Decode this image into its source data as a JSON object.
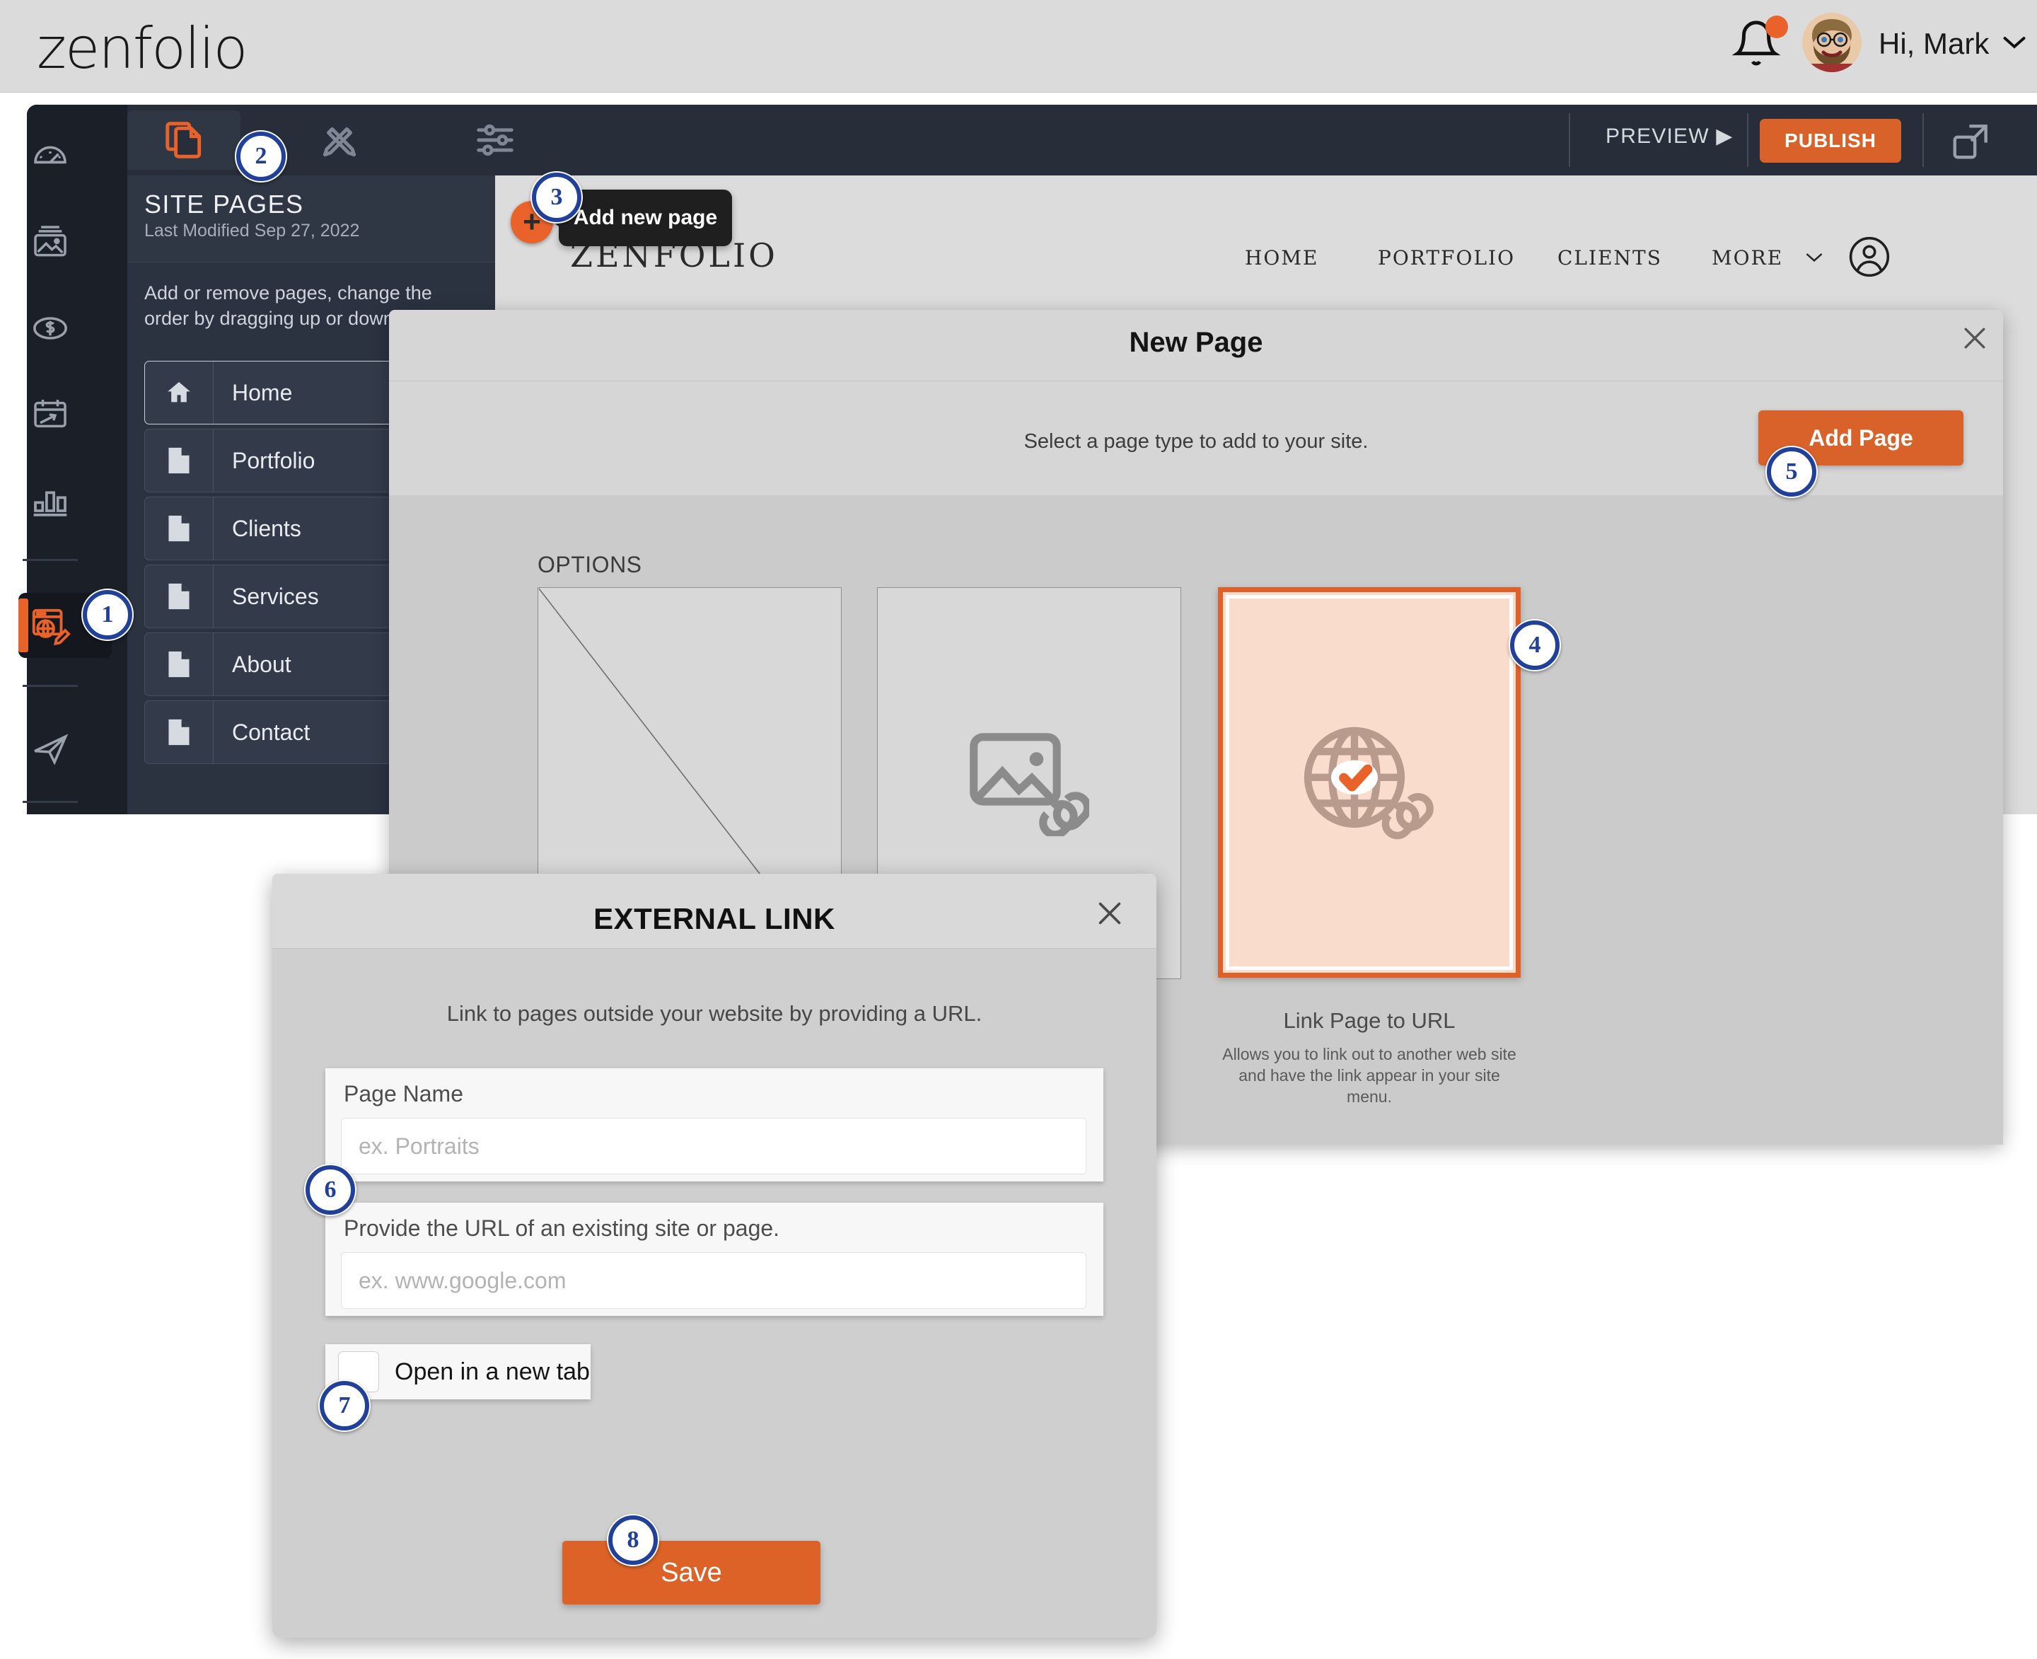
{
  "brand": {
    "logo": "zenfolio"
  },
  "header": {
    "greeting": "Hi, Mark",
    "bell_icon": "bell-icon",
    "notification_dot": true,
    "avatar_icon": "user-avatar"
  },
  "toolbar": {
    "tabs": [
      {
        "icon": "pages-copy-icon",
        "active": true
      },
      {
        "icon": "design-tools-icon",
        "active": false
      },
      {
        "icon": "settings-sliders-icon",
        "active": false
      }
    ],
    "preview_label": "PREVIEW ▶",
    "publish_label": "PUBLISH",
    "expand_icon": "expand-icon"
  },
  "rail": {
    "items": [
      {
        "icon": "dashboard-gauge-icon"
      },
      {
        "icon": "gallery-image-icon"
      },
      {
        "icon": "money-dollar-icon"
      },
      {
        "icon": "calendar-booking-icon"
      },
      {
        "icon": "analytics-bars-icon"
      },
      {
        "icon": "website-editor-icon",
        "active": true
      },
      {
        "icon": "send-paper-plane-icon"
      }
    ]
  },
  "site_pages": {
    "title": "SITE PAGES",
    "last_modified": "Last Modified Sep 27, 2022",
    "description": "Add or remove pages, change the order by dragging up or down.",
    "add_button_icon": "plus-icon",
    "tooltip": "Add new page",
    "rows": [
      {
        "label": "Home",
        "icon": "home-icon"
      },
      {
        "label": "Portfolio",
        "icon": "page-icon"
      },
      {
        "label": "Clients",
        "icon": "page-icon"
      },
      {
        "label": "Services",
        "icon": "page-icon"
      },
      {
        "label": "About",
        "icon": "page-icon"
      },
      {
        "label": "Contact",
        "icon": "page-icon"
      }
    ]
  },
  "site_preview": {
    "logo": "ZENFOLIO",
    "nav": [
      "HOME",
      "PORTFOLIO",
      "CLIENTS"
    ],
    "more_label": "MORE",
    "account_icon": "account-circle-icon"
  },
  "new_page_modal": {
    "title": "New Page",
    "close_icon": "close-icon",
    "subtitle": "Select a page type to add to your site.",
    "add_page_label": "Add Page",
    "options_label": "OPTIONS",
    "cards": [
      {
        "title": "",
        "description": "",
        "icon": "blank-page-icon",
        "selected": false
      },
      {
        "title": "",
        "description": "",
        "icon": "image-link-icon",
        "selected": false
      },
      {
        "title": "Link Page to URL",
        "description": "Allows you to link out to another web site and have the link appear in your site menu.",
        "icon": "globe-link-icon",
        "selected": true
      }
    ]
  },
  "external_link_modal": {
    "title": "EXTERNAL LINK",
    "close_icon": "close-icon",
    "description": "Link to pages outside your website by providing a URL.",
    "page_name_label": "Page Name",
    "page_name_placeholder": "ex. Portraits",
    "page_name_value": "",
    "url_label": "Provide the URL of an existing site or page.",
    "url_placeholder": "ex. www.google.com",
    "url_value": "",
    "new_tab_label": "Open in a new tab",
    "new_tab_checked": false,
    "save_label": "Save"
  },
  "badges": {
    "b1": "1",
    "b2": "2",
    "b3": "3",
    "b4": "4",
    "b5": "5",
    "b6": "6",
    "b7": "7",
    "b8": "8"
  },
  "colors": {
    "accent_orange": "#e8622a",
    "publish_orange": "#d9622a",
    "dark_panel": "#272e3a",
    "rail_dark": "#1b1f28",
    "badge_blue": "#21409a",
    "card_selected_bg": "#fadccc"
  }
}
